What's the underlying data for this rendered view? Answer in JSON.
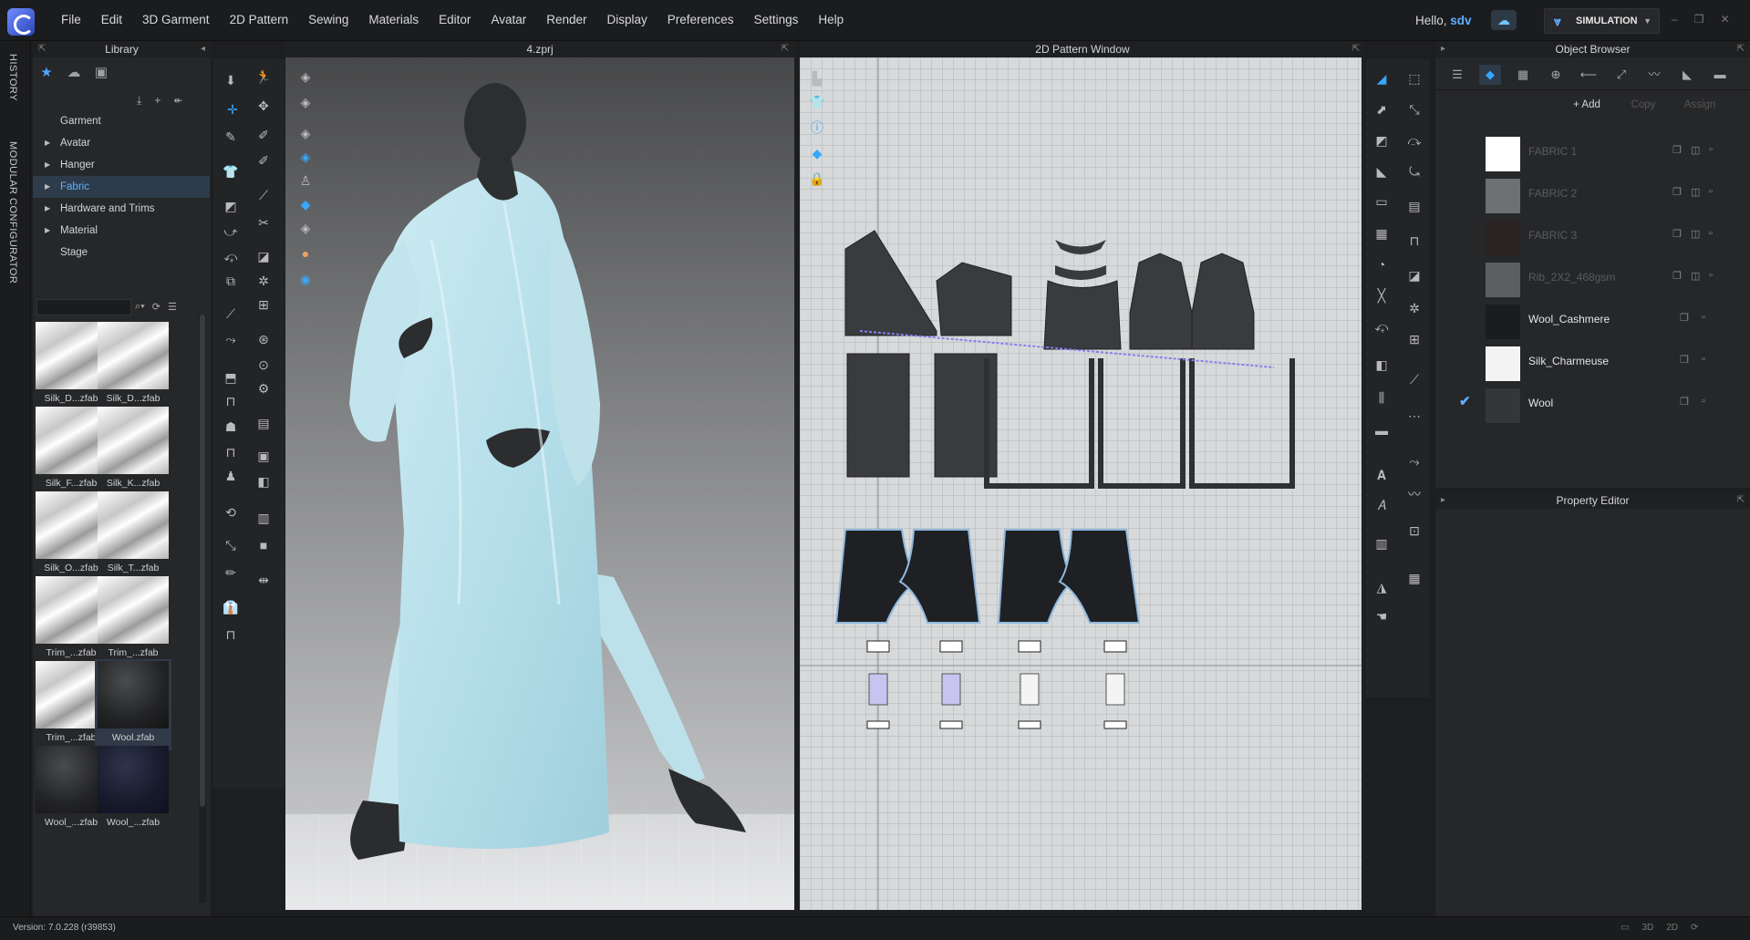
{
  "app": {
    "menu": [
      "File",
      "Edit",
      "3D Garment",
      "2D Pattern",
      "Sewing",
      "Materials",
      "Editor",
      "Avatar",
      "Render",
      "Display",
      "Preferences",
      "Settings",
      "Help"
    ],
    "greeting": "Hello, ",
    "user": "sdv",
    "mode_button": "SIMULATION",
    "accent_color": "#35a8ff"
  },
  "side_strip": {
    "history": "HISTORY",
    "modular": "MODULAR CONFIGURATOR"
  },
  "library": {
    "title": "Library",
    "tree": [
      {
        "label": "Garment",
        "expandable": false
      },
      {
        "label": "Avatar",
        "expandable": true
      },
      {
        "label": "Hanger",
        "expandable": true
      },
      {
        "label": "Fabric",
        "expandable": true,
        "selected": true
      },
      {
        "label": "Hardware and Trims",
        "expandable": true
      },
      {
        "label": "Material",
        "expandable": true
      },
      {
        "label": "Stage",
        "expandable": false
      }
    ],
    "thumbnails": [
      {
        "label": "Silk_D...zfab",
        "style": "silk"
      },
      {
        "label": "Silk_D...zfab",
        "style": "silk"
      },
      {
        "label": "Silk_F...zfab",
        "style": "silk"
      },
      {
        "label": "Silk_K...zfab",
        "style": "silk"
      },
      {
        "label": "Silk_O...zfab",
        "style": "silk"
      },
      {
        "label": "Silk_T...zfab",
        "style": "silk"
      },
      {
        "label": "Trim_...zfab",
        "style": "silk"
      },
      {
        "label": "Trim_...zfab",
        "style": "silk"
      },
      {
        "label": "Trim_...zfab",
        "style": "silk"
      },
      {
        "label": "Wool.zfab",
        "style": "dark",
        "selected": true
      },
      {
        "label": "Wool_...zfab",
        "style": "dark"
      },
      {
        "label": "Wool_...zfab",
        "style": "navy"
      }
    ]
  },
  "view3d": {
    "title": "4.zprj"
  },
  "view2d": {
    "title": "2D Pattern Window"
  },
  "object_browser": {
    "title": "Object Browser",
    "actions": [
      {
        "label": "+ Add",
        "enabled": true
      },
      {
        "label": "Copy",
        "enabled": false
      },
      {
        "label": "Assign",
        "enabled": false
      }
    ],
    "fabrics": [
      {
        "name": "FABRIC 1",
        "color": "#ffffff",
        "dim": true,
        "checked": false
      },
      {
        "name": "FABRIC 2",
        "color": "#6e6f71",
        "dim": true,
        "checked": false
      },
      {
        "name": "FABRIC 3",
        "color": "#2b2223",
        "dim": true,
        "checked": false
      },
      {
        "name": "Rib_2X2_468gsm",
        "color": "#5d5e60",
        "dim": true,
        "checked": false
      },
      {
        "name": "Wool_Cashmere",
        "color": "#1b1c1f",
        "dim": false,
        "checked": false
      },
      {
        "name": "Silk_Charmeuse",
        "color": "#f2f3f2",
        "dim": false,
        "checked": false
      },
      {
        "name": "Wool",
        "color": "#35363a",
        "dim": false,
        "checked": true
      }
    ]
  },
  "property_editor": {
    "title": "Property Editor"
  },
  "status": {
    "version": "Version: 7.0.228 (r39853)",
    "view_modes": [
      "▭",
      "3D",
      "2D",
      "⟳"
    ]
  }
}
